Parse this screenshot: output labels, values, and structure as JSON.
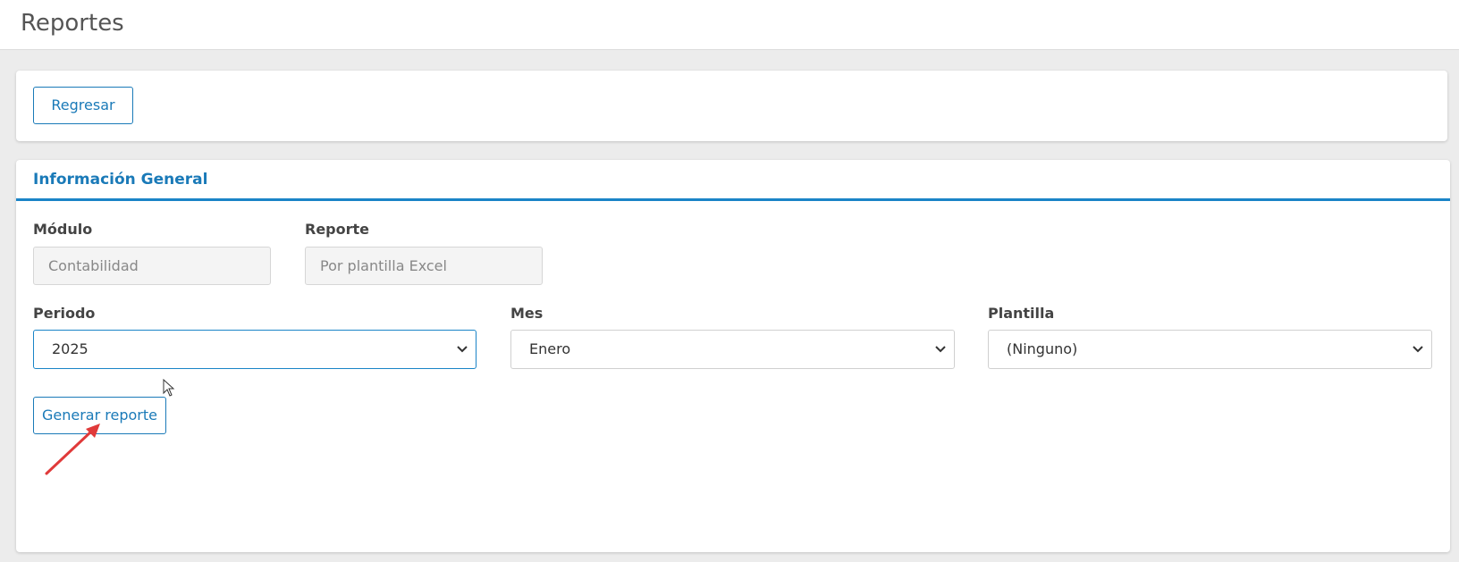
{
  "header": {
    "title": "Reportes"
  },
  "top_card": {
    "back_label": "Regresar"
  },
  "general": {
    "section_title": "Información General",
    "modulo": {
      "label": "Módulo",
      "value": "Contabilidad"
    },
    "reporte": {
      "label": "Reporte",
      "value": "Por plantilla Excel"
    },
    "periodo": {
      "label": "Periodo",
      "selected": "2025"
    },
    "mes": {
      "label": "Mes",
      "selected": "Enero"
    },
    "plantilla": {
      "label": "Plantilla",
      "selected": "(Ninguno)"
    },
    "generate_label": "Generar reporte"
  },
  "colors": {
    "accent": "#1a7ab8",
    "annotation": "#e03a3a"
  },
  "icons": {
    "select_caret": "chevron-down-icon",
    "pointer": "mouse-cursor-icon",
    "annotation": "arrow-icon"
  }
}
